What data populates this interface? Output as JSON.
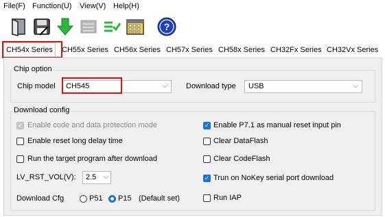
{
  "menu": [
    "File(F)",
    "Function(U)",
    "View(V)",
    "Help(H)"
  ],
  "toolbar": {
    "icons": [
      "open-file-icon",
      "save-file-icon",
      "download-arrow-icon",
      "erase-icon",
      "verify-icon",
      "calculator-icon",
      "help-icon"
    ],
    "help_glyph": "?"
  },
  "tabs": [
    "CH54x Series",
    "CH55x Series",
    "CH56x Series",
    "CH57x Series",
    "CH58x Series",
    "CH32Fx Series",
    "CH32Vx Series"
  ],
  "chip_option": {
    "title": "Chip option",
    "chip_model_label": "Chip model",
    "chip_model_value": "CH545",
    "download_type_label": "Download type",
    "download_type_value": "USB"
  },
  "download_config": {
    "title": "Download config",
    "options": {
      "code_protection": "Enable code and data protection mode",
      "reset_long_delay": "Enable reset long delay time",
      "run_after_download": "Run the target program after download",
      "p71_reset": "Enable P7.1 as manual reset input pin",
      "clear_dataflash": "Clear DataFlash",
      "clear_codeflash": "Clear CodeFlash",
      "nokey_serial": "Trun on NoKey serial port download",
      "run_iap": "Run IAP"
    },
    "lv_rst_label": "LV_RST_VOL(V):",
    "lv_rst_value": "2.5",
    "download_cfg_label": "Download Cfg",
    "radio_p51": "P51",
    "radio_p15": "P15",
    "default_set": "(Default set)"
  },
  "colors": {
    "accent": "#1a73d9",
    "highlight": "#e01010"
  }
}
